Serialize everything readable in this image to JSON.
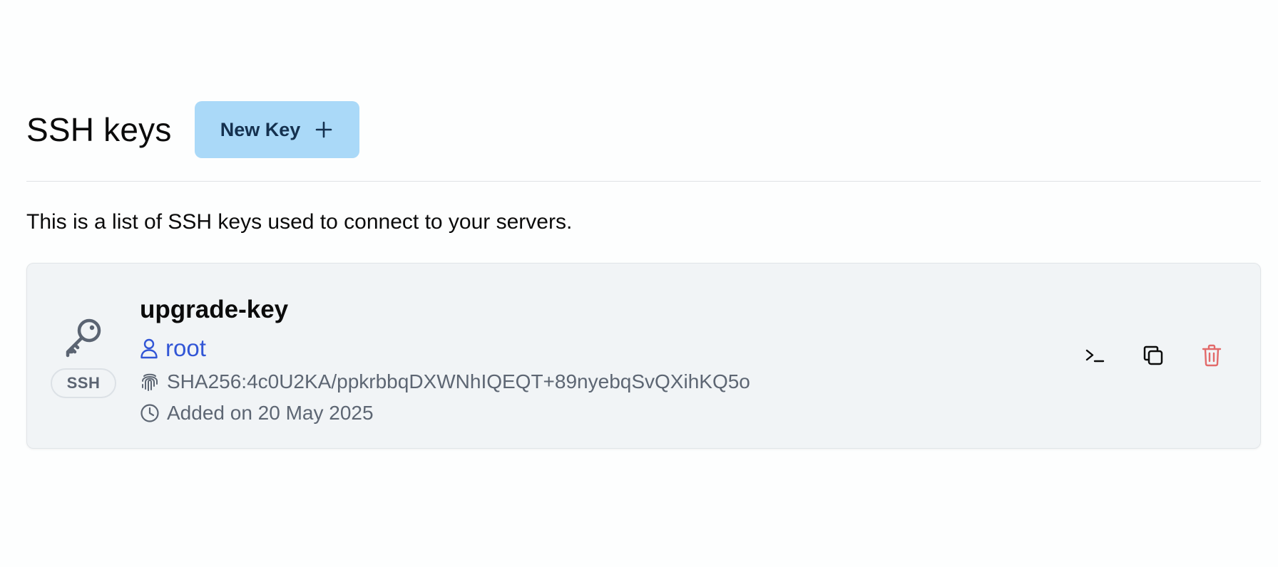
{
  "page": {
    "title": "SSH keys",
    "new_key_label": "New Key",
    "new_key_icon": "plus-icon",
    "description": "This is a list of SSH keys used to connect to your servers."
  },
  "keys": [
    {
      "name": "upgrade-key",
      "type": "SSH",
      "user": "root",
      "fingerprint": "SHA256:4c0U2KA/ppkrbbqDXWNhIQEQT+89nyebqSvQXihKQ5o",
      "added": "Added on 20 May 2025",
      "icons": {
        "key": "key-icon",
        "user": "user-icon",
        "fingerprint": "fingerprint-icon",
        "date": "clock-icon"
      },
      "actions": [
        {
          "name": "terminal-icon",
          "action": "connect"
        },
        {
          "name": "copy-icon",
          "action": "copy"
        },
        {
          "name": "trash-icon",
          "action": "delete"
        }
      ]
    }
  ],
  "colors": {
    "accent_button_bg": "#aad9f8",
    "accent_button_text": "#15314f",
    "user_link": "#3256d6",
    "muted_text": "#5d6673",
    "card_bg": "#f1f4f6",
    "danger": "#e26a6a"
  }
}
